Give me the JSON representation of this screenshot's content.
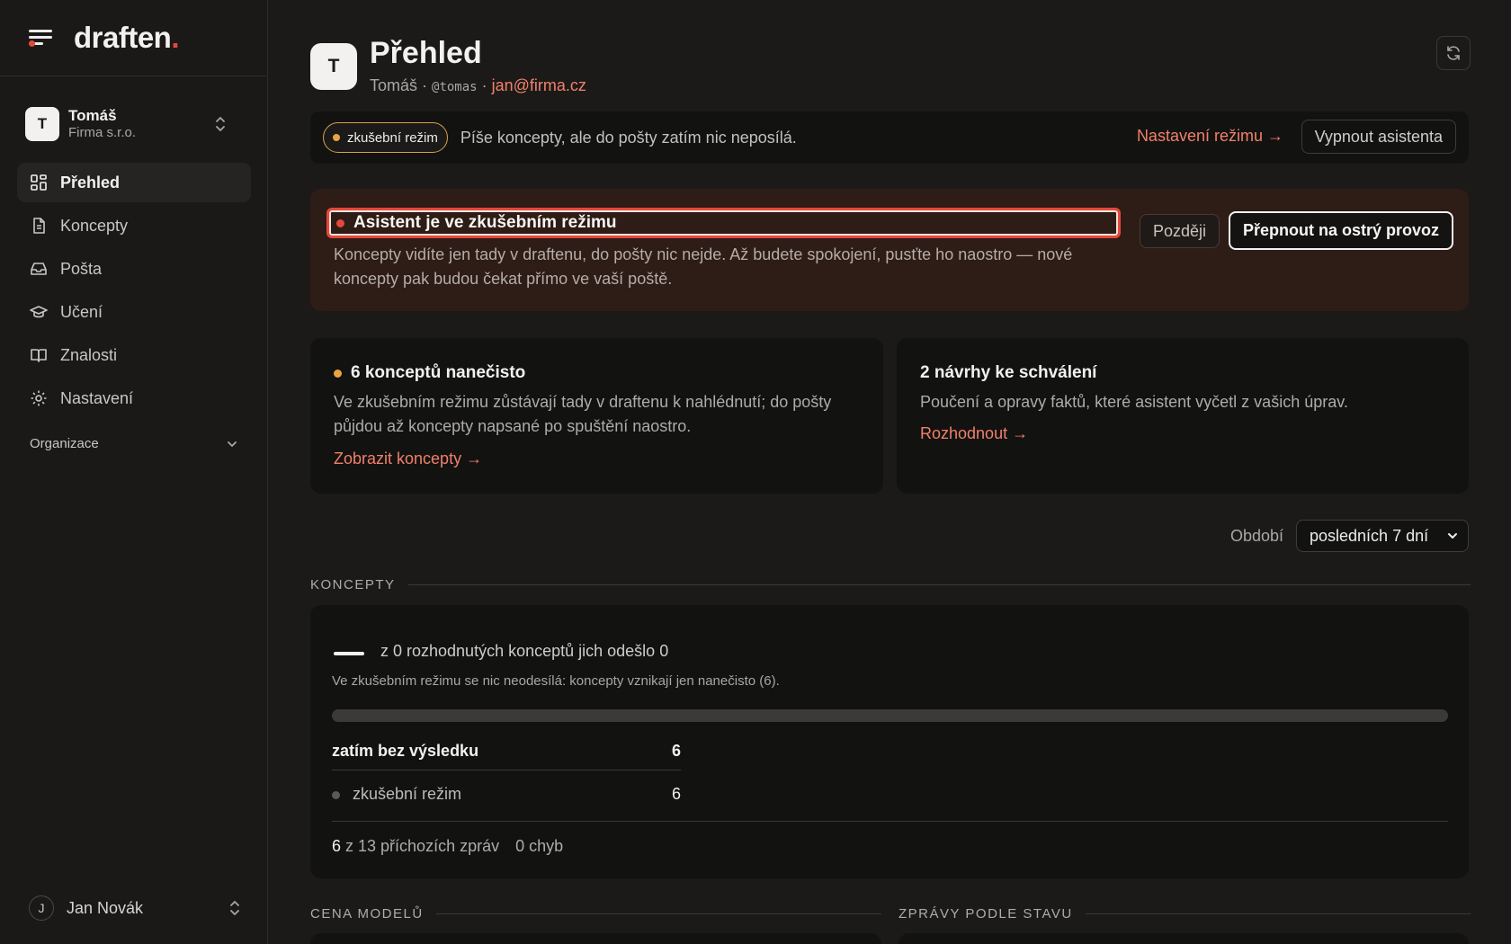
{
  "app": {
    "logo": "draften",
    "logo_dot": "."
  },
  "org": {
    "avatar": "T",
    "name": "Tomáš",
    "company": "Firma s.r.o."
  },
  "nav": {
    "items": [
      {
        "label": "Přehled",
        "icon": "dashboard-icon"
      },
      {
        "label": "Koncepty",
        "icon": "document-icon"
      },
      {
        "label": "Pošta",
        "icon": "inbox-icon"
      },
      {
        "label": "Učení",
        "icon": "graduation-cap-icon"
      },
      {
        "label": "Znalosti",
        "icon": "book-icon"
      },
      {
        "label": "Nastavení",
        "icon": "gear-icon"
      }
    ],
    "section": "Organizace"
  },
  "user": {
    "avatar": "J",
    "name": "Jan Novák"
  },
  "header": {
    "avatar": "T",
    "title": "Přehled",
    "name": "Tomáš",
    "sep1": " · ",
    "handle": "@tomas",
    "sep2": " · ",
    "email": "jan@firma.cz"
  },
  "mode_bar": {
    "pill": "zkušební režim",
    "description": "Píše koncepty, ale do pošty zatím nic neposílá.",
    "settings_link": "Nastavení režimu →",
    "disable_button": "Vypnout asistenta"
  },
  "alert": {
    "title": "Asistent je ve zkušebním režimu",
    "text": "Koncepty vidíte jen tady v draftenu, do pošty nic nejde. Až budete spokojení, pusťte ho naostro — nové koncepty pak budou čekat přímo ve vaší poště.",
    "later_button": "Později",
    "switch_button": "Přepnout na ostrý provoz"
  },
  "cards": [
    {
      "title": "6 konceptů nanečisto",
      "text": "Ve zkušebním režimu zůstávají tady v draftenu k nahlédnutí; do pošty půjdou až koncepty napsané po spuštění naostro.",
      "link": "Zobrazit koncepty →"
    },
    {
      "title": "2 návrhy ke schválení",
      "text": "Poučení a opravy faktů, které asistent vyčetl z vašich úprav.",
      "link": "Rozhodnout →"
    }
  ],
  "period": {
    "label": "Období",
    "value": "posledních 7 dní"
  },
  "sections": {
    "koncepty": "KONCEPTY",
    "cena": "CENA MODELŮ",
    "zpravy": "ZPRÁVY PODLE STAVU"
  },
  "stats": {
    "headline": "z 0 rozhodnutých konceptů jich odešlo 0",
    "note": "Ve zkušebním režimu se nic neodesílá: koncepty vznikají jen nanečisto (6).",
    "progress": 0,
    "row_main_label": "zatím bez výsledku",
    "row_main_value": "6",
    "row_sub_label": "zkušební režim",
    "row_sub_value": "6",
    "foot_count": "6",
    "foot_text": " z 13 příchozích zpráv",
    "foot_errors": "0 chyb"
  },
  "colors": {
    "accent": "#e5483b",
    "link": "#f0806a",
    "warning": "#e9a441"
  }
}
